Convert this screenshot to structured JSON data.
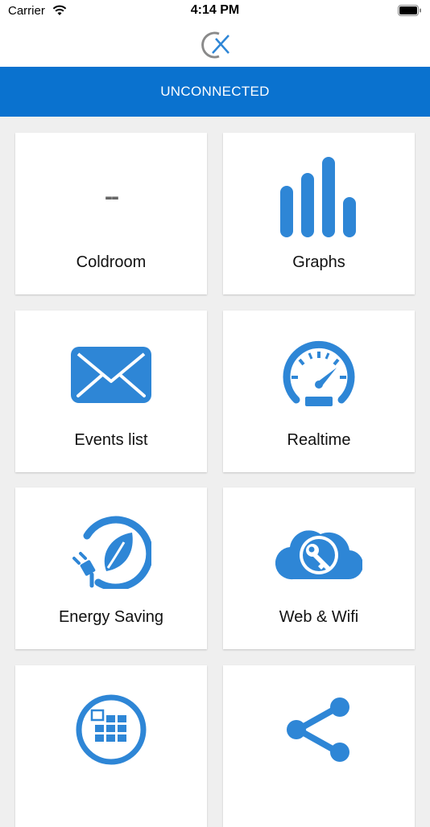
{
  "status_bar": {
    "carrier": "Carrier",
    "time": "4:14 PM"
  },
  "banner": {
    "text": "UNCONNECTED"
  },
  "colors": {
    "accent": "#2e86d6",
    "banner": "#0a72cf",
    "background": "#efefef"
  },
  "tiles": [
    {
      "label": "Coldroom",
      "value": "--",
      "icon": "dash"
    },
    {
      "label": "Graphs",
      "icon": "bar-chart-icon"
    },
    {
      "label": "Events list",
      "icon": "envelope-icon"
    },
    {
      "label": "Realtime",
      "icon": "speedometer-icon"
    },
    {
      "label": "Energy Saving",
      "icon": "leaf-plug-icon"
    },
    {
      "label": "Web & Wifi",
      "icon": "cloud-key-icon"
    },
    {
      "label": "",
      "icon": "grid-icon"
    },
    {
      "label": "",
      "icon": "share-icon"
    }
  ]
}
